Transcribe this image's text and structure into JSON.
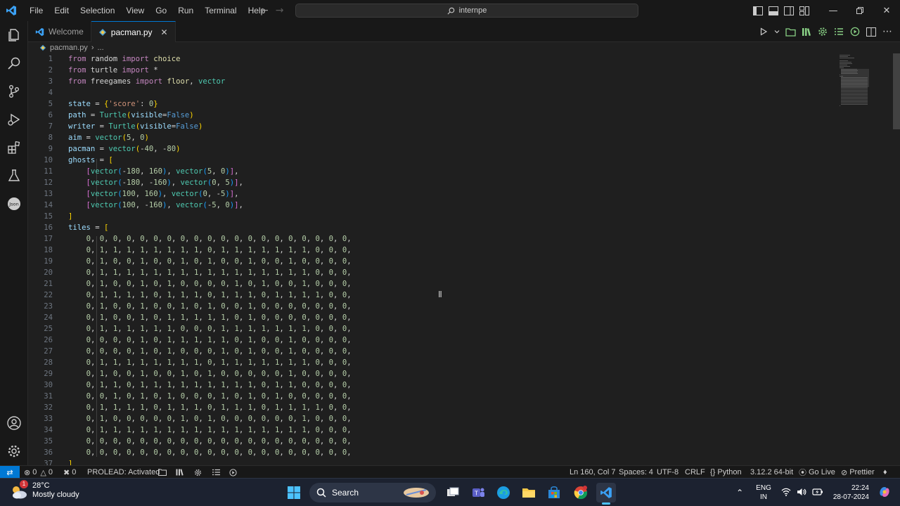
{
  "titlebar": {
    "menu": [
      "File",
      "Edit",
      "Selection",
      "View",
      "Go",
      "Run",
      "Terminal",
      "Help"
    ],
    "search_text": "internpe"
  },
  "tabs": [
    {
      "label": "Welcome",
      "active": false
    },
    {
      "label": "pacman.py",
      "active": true
    }
  ],
  "breadcrumb": {
    "file": "pacman.py",
    "rest": "..."
  },
  "editor": {
    "line_numbers": [
      "1",
      "2",
      "3",
      "4",
      "5",
      "6",
      "7",
      "8",
      "9",
      "10",
      "11",
      "12",
      "13",
      "14",
      "15",
      "16",
      "17",
      "18",
      "19",
      "20",
      "21",
      "22",
      "23",
      "24",
      "25",
      "26",
      "27",
      "28",
      "29",
      "30",
      "31",
      "32",
      "33",
      "34",
      "35",
      "36",
      "37"
    ],
    "code_lines": [
      "from random import choice",
      "from turtle import *",
      "from freegames import floor, vector",
      "",
      "state = {'score': 0}",
      "path = Turtle(visible=False)",
      "writer = Turtle(visible=False)",
      "aim = vector(5, 0)",
      "pacman = vector(-40, -80)",
      "ghosts = [",
      "    [vector(-180, 160), vector(5, 0)],",
      "    [vector(-180, -160), vector(0, 5)],",
      "    [vector(100, 160), vector(0, -5)],",
      "    [vector(100, -160), vector(-5, 0)],",
      "]",
      "tiles = [",
      "    0, 0, 0, 0, 0, 0, 0, 0, 0, 0, 0, 0, 0, 0, 0, 0, 0, 0, 0, 0,",
      "    0, 1, 1, 1, 1, 1, 1, 1, 1, 0, 1, 1, 1, 1, 1, 1, 1, 0, 0, 0,",
      "    0, 1, 0, 0, 1, 0, 0, 1, 0, 1, 0, 0, 1, 0, 0, 1, 0, 0, 0, 0,",
      "    0, 1, 1, 1, 1, 1, 1, 1, 1, 1, 1, 1, 1, 1, 1, 1, 1, 0, 0, 0,",
      "    0, 1, 0, 0, 1, 0, 1, 0, 0, 0, 0, 1, 0, 1, 0, 0, 1, 0, 0, 0,",
      "    0, 1, 1, 1, 1, 0, 1, 1, 1, 0, 1, 1, 1, 0, 1, 1, 1, 1, 0, 0,",
      "    0, 1, 0, 0, 1, 0, 0, 1, 0, 1, 0, 0, 1, 0, 0, 0, 0, 0, 0, 0,",
      "    0, 1, 0, 0, 1, 0, 1, 1, 1, 1, 1, 0, 1, 0, 0, 0, 0, 0, 0, 0,",
      "    0, 1, 1, 1, 1, 1, 1, 0, 0, 0, 1, 1, 1, 1, 1, 1, 1, 0, 0, 0,",
      "    0, 0, 0, 0, 1, 0, 1, 1, 1, 1, 1, 0, 1, 0, 0, 1, 0, 0, 0, 0,",
      "    0, 0, 0, 0, 1, 0, 1, 0, 0, 0, 1, 0, 1, 0, 0, 1, 0, 0, 0, 0,",
      "    0, 1, 1, 1, 1, 1, 1, 1, 1, 0, 1, 1, 1, 1, 1, 1, 1, 0, 0, 0,",
      "    0, 1, 0, 0, 1, 0, 0, 1, 0, 1, 0, 0, 0, 0, 0, 1, 0, 0, 0, 0,",
      "    0, 1, 1, 0, 1, 1, 1, 1, 1, 1, 1, 1, 1, 0, 1, 1, 0, 0, 0, 0,",
      "    0, 0, 1, 0, 1, 0, 1, 0, 0, 0, 1, 0, 1, 0, 1, 0, 0, 0, 0, 0,",
      "    0, 1, 1, 1, 1, 0, 1, 1, 1, 0, 1, 1, 1, 0, 1, 1, 1, 1, 0, 0,",
      "    0, 1, 0, 0, 0, 0, 0, 1, 0, 1, 0, 0, 0, 0, 0, 0, 1, 0, 0, 0,",
      "    0, 1, 1, 1, 1, 1, 1, 1, 1, 1, 1, 1, 1, 1, 1, 1, 1, 0, 0, 0,",
      "    0, 0, 0, 0, 0, 0, 0, 0, 0, 0, 0, 0, 0, 0, 0, 0, 0, 0, 0, 0,",
      "    0, 0, 0, 0, 0, 0, 0, 0, 0, 0, 0, 0, 0, 0, 0, 0, 0, 0, 0, 0,",
      "]"
    ]
  },
  "statusbar": {
    "errors": "0",
    "warnings": "0",
    "ports": "0",
    "prolead": "PROLEAD: Activated",
    "position": "Ln 160, Col 7",
    "spaces": "Spaces: 4",
    "encoding": "UTF-8",
    "eol": "CRLF",
    "language": "Python",
    "interpreter": "3.12.2 64-bit",
    "golive": "Go Live",
    "prettier": "Prettier"
  },
  "taskbar": {
    "temperature": "28°C",
    "weather": "Mostly cloudy",
    "weather_badge": "1",
    "search": "Search",
    "lang_top": "ENG",
    "lang_bottom": "IN",
    "time": "22:24",
    "date": "28-07-2024"
  },
  "colors": {
    "accent": "#0078d4",
    "keyword": "#c586c0",
    "function": "#dcdcaa",
    "class": "#4ec9b0",
    "variable": "#9cdcfe",
    "number": "#b5cea8",
    "string": "#ce9178"
  }
}
